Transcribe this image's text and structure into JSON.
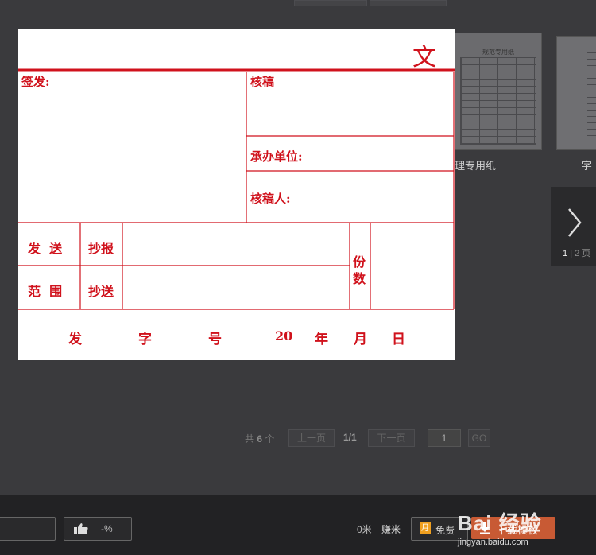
{
  "gallery": {
    "thumb1_title": "规范专用纸",
    "thumb1_caption": "理专用纸",
    "thumb2_caption": "字"
  },
  "carousel": {
    "page_current": "1",
    "page_rest": "| 2 页"
  },
  "form": {
    "doc_char": "文",
    "sign_label": "签发:",
    "check_label": "核稿",
    "unit_label": "承办单位:",
    "checker_label": "核稿人:",
    "send_l1": "发  送",
    "send_l2": "范  围",
    "report_label": "抄报",
    "copy_label": "抄送",
    "copies_l1": "份",
    "copies_l2": "数",
    "footer": {
      "fa": "发",
      "zi": "字",
      "hao": "号",
      "year_prefix": "20",
      "nian": "年",
      "yue": "月",
      "ri": "日"
    }
  },
  "pager": {
    "total_prefix": "共",
    "total_count": "6",
    "total_suffix": "个",
    "prev": "上一页",
    "current": "1/1",
    "next": "下一页",
    "input_value": "1",
    "go": "GO"
  },
  "bottom_bar": {
    "like_pct": "-%",
    "meters": "0米",
    "earn": "赚米",
    "free_icon": "月",
    "free_label": "免费",
    "download_label": "下载模板"
  },
  "watermark": {
    "brand": "Bai 经验",
    "url": "jingyan.baidu.com"
  },
  "colors": {
    "form_red": "#d0121c",
    "backdrop": "#3a3a3d",
    "bottom_bar": "#222224",
    "download_btn": "#c85a34",
    "free_icon": "#f0a020"
  }
}
